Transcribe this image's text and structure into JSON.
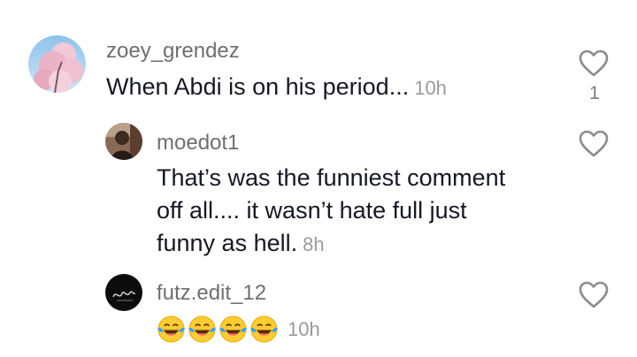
{
  "comments": [
    {
      "username": "zoey_grendez",
      "lines": [
        "When Abdi is on his period..."
      ],
      "time": "10h",
      "like_count": "1",
      "avatar_icon": "cherry-blossom-photo"
    },
    {
      "username": "moedot1",
      "lines": [
        "That’s was the funniest comment",
        "off all.... it wasn’t hate full just",
        "funny as hell."
      ],
      "time": "8h",
      "avatar_icon": "profile-photo"
    },
    {
      "username": "futz.edit_12",
      "emojis": [
        "😂",
        "😂",
        "😂",
        "😂"
      ],
      "time": "10h",
      "avatar_icon": "signature-logo"
    }
  ],
  "colors": {
    "username": "#6f6f73",
    "body": "#161823",
    "time": "#9a9a9e",
    "icon": "#8a8b91"
  }
}
